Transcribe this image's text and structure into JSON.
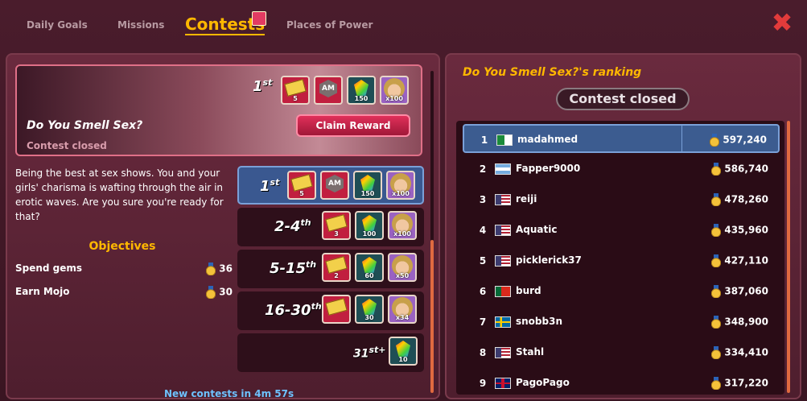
{
  "tabs": {
    "daily_goals": "Daily Goals",
    "missions": "Missions",
    "contests": "Contests",
    "places_of_power": "Places of Power"
  },
  "contest": {
    "title": "Do You Smell Sex?",
    "status": "Contest closed",
    "claim_label": "Claim Reward",
    "top_rank": "1",
    "top_rank_suffix": "st",
    "top_rewards": [
      "5",
      "",
      "150",
      "x100"
    ],
    "description": "Being the best at sex shows. You and your girls' charisma is wafting through the air in erotic waves. Are you sure you're ready for that?",
    "objectives_title": "Objectives",
    "objectives": [
      {
        "label": "Spend gems",
        "points": "36"
      },
      {
        "label": "Earn Mojo",
        "points": "30"
      }
    ],
    "reward_tiers": [
      {
        "rank": "1",
        "suffix": "st",
        "book": "5",
        "gem": "150",
        "girl": "x100"
      },
      {
        "rank": "2-4",
        "suffix": "th",
        "book": "3",
        "gem": "100",
        "girl": "x100"
      },
      {
        "rank": "5-15",
        "suffix": "th",
        "book": "2",
        "gem": "60",
        "girl": "x50"
      },
      {
        "rank": "16-30",
        "suffix": "th",
        "book": "",
        "gem": "30",
        "girl": "x34"
      },
      {
        "rank": "31",
        "suffix": "st+",
        "gem": "10"
      }
    ],
    "new_contests": "New contests in 4m 57s"
  },
  "ranking": {
    "title": "Do You Smell Sex?'s ranking",
    "status": "Contest closed",
    "rows": [
      {
        "pos": "1",
        "flag": "algeria",
        "name": "madahmed",
        "score": "597,240"
      },
      {
        "pos": "2",
        "flag": "argentina",
        "name": "Fapper9000",
        "score": "586,740"
      },
      {
        "pos": "3",
        "flag": "usa",
        "name": "reiji",
        "score": "478,260"
      },
      {
        "pos": "4",
        "flag": "usa",
        "name": "Aquatic",
        "score": "435,960"
      },
      {
        "pos": "5",
        "flag": "usa",
        "name": "picklerick37",
        "score": "427,110"
      },
      {
        "pos": "6",
        "flag": "portugal",
        "name": "burd",
        "score": "387,060"
      },
      {
        "pos": "7",
        "flag": "sweden",
        "name": "snobb3n",
        "score": "348,900"
      },
      {
        "pos": "8",
        "flag": "usa",
        "name": "Stahl",
        "score": "334,410"
      },
      {
        "pos": "9",
        "flag": "uk",
        "name": "PagoPago",
        "score": "317,220"
      }
    ]
  },
  "colors": {
    "accent": "#ffb800",
    "highlight": "#3c5c90",
    "close": "#e23b3b"
  }
}
